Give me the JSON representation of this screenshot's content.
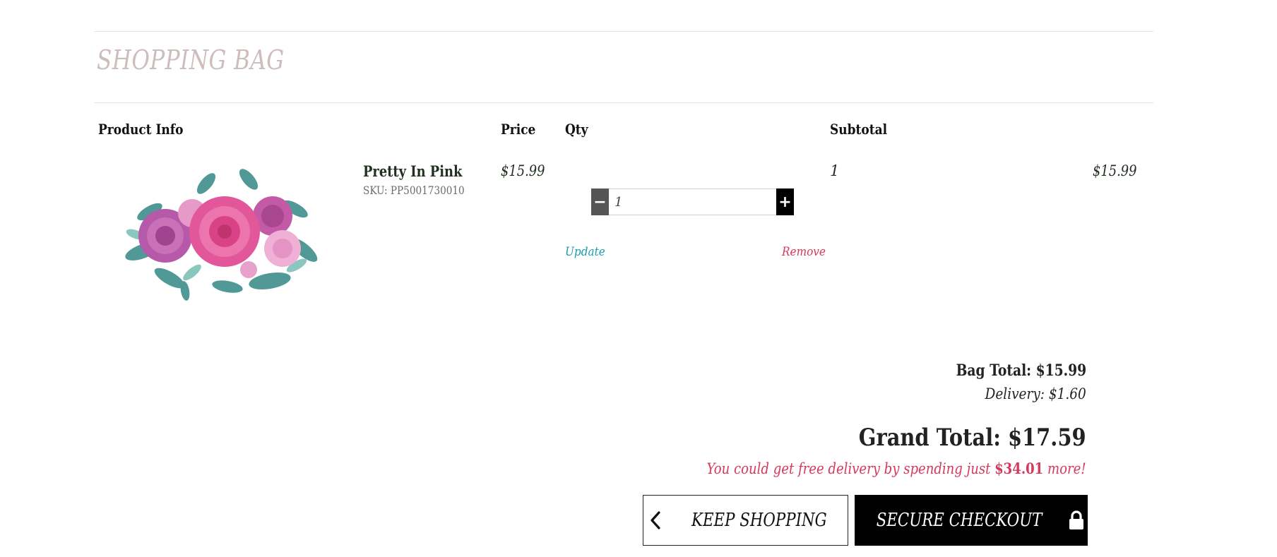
{
  "page": {
    "title": "SHOPPING BAG"
  },
  "table": {
    "headers": {
      "product_info": "Product Info",
      "price": "Price",
      "qty": "Qty",
      "subtotal": "Subtotal"
    }
  },
  "item": {
    "name": "Pretty In Pink",
    "sku": "SKU: PP5001730010",
    "price": "$15.99",
    "quantity": "1",
    "quantity_value": "1",
    "subtotal": "$15.99",
    "image": "pink-rose-bouquet-illustration",
    "update_label": "Update",
    "remove_label": "Remove",
    "minus_label": "−",
    "plus_label": "+"
  },
  "summary": {
    "bag_total": "Bag Total: $15.99",
    "delivery": "Delivery: $1.60",
    "grand_total": "Grand Total: $17.59",
    "free_delivery_prefix": "You could get free delivery by spending just",
    "free_delivery_amount": "$34.01",
    "free_delivery_suffix": "more!"
  },
  "actions": {
    "keep_shopping": "KEEP SHOPPING",
    "keep_shopping_icon": "chevron-left-icon",
    "secure_checkout": "SECURE CHECKOUT",
    "secure_checkout_icon": "lock-icon"
  },
  "colors": {
    "title": "#cdbdbd",
    "update_link": "#1e9bb0",
    "remove_link": "#d6385c",
    "free_delivery_text": "#d6385c",
    "checkout_bg": "#000000"
  }
}
